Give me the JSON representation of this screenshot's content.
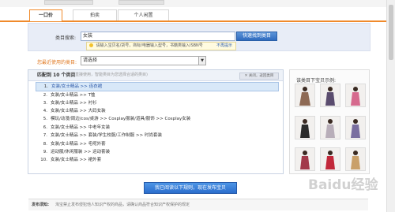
{
  "tabs": [
    {
      "label": "一口价"
    },
    {
      "label": "拍卖"
    },
    {
      "label": "个人闲置"
    }
  ],
  "search": {
    "label": "类目搜索:",
    "value": "女装",
    "button": "快速找到类目",
    "hint": "请输入宝贝名/货号，商标/电器输入型号，书籍类输入ISBN号",
    "hint_link": "不再提示"
  },
  "recent": {
    "label": "您最近使用的类目:",
    "selected": "请选择"
  },
  "match": {
    "title": "匹配到 10 个类目",
    "subtitle": "(仅供直接使用，智能类目为您选择合适的类目)",
    "close_label": "关闭，返回类目",
    "items": [
      {
        "num": "1.",
        "path": "女装/女士精品 >> 连衣裙"
      },
      {
        "num": "2.",
        "path": "女装/女士精品 >> T恤"
      },
      {
        "num": "3.",
        "path": "女装/女士精品 >> 衬衫"
      },
      {
        "num": "4.",
        "path": "女装/女士精品 >> 大码女装"
      },
      {
        "num": "5.",
        "path": "模玩/动漫/周边/cos/桌游 >> Cosplay服装/道具/服饰 >> Cosplay女装"
      },
      {
        "num": "6.",
        "path": "女装/女士精品 >> 中老年女装"
      },
      {
        "num": "7.",
        "path": "女装/女士精品 >> 套装/学生校服/工作制服 >> 时尚套装"
      },
      {
        "num": "8.",
        "path": "女装/女士精品 >> 毛呢外套"
      },
      {
        "num": "9.",
        "path": "运动服/休闲服装 >> 运动套装"
      },
      {
        "num": "10.",
        "path": "女装/女士精品 >> 裙外套"
      }
    ]
  },
  "pics": {
    "title": "该类目下宝贝示例:"
  },
  "confirm_button": "我已阅读以下规则，现在发布宝贝",
  "footer": {
    "head": "发布须知:",
    "body": "淘宝禁止发布侵犯他人知识产权的商品，请确认商品符合知识产权保护的规定"
  },
  "watermark": "Baidu经验"
}
